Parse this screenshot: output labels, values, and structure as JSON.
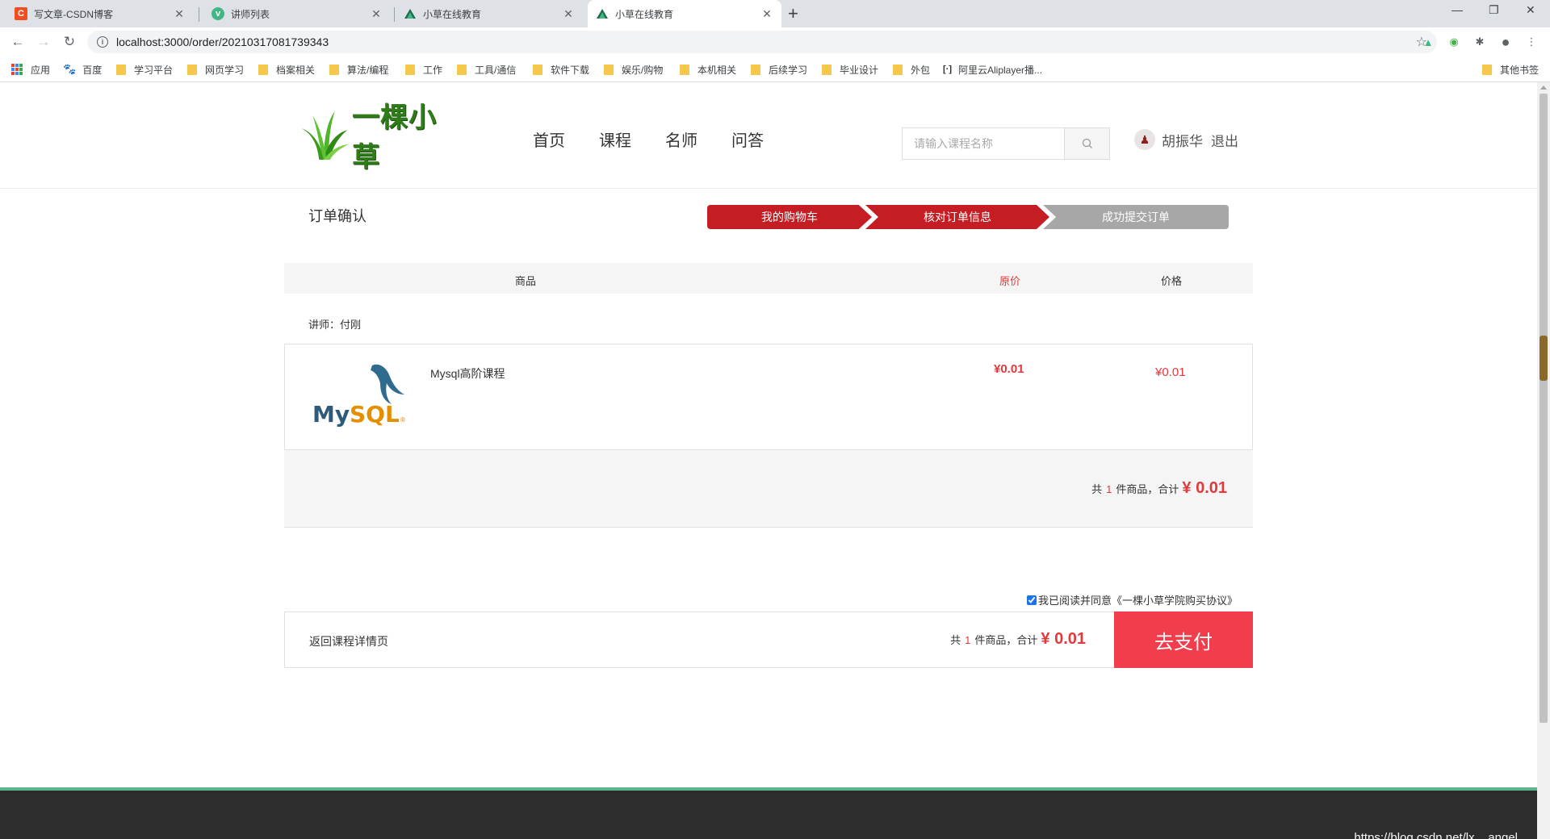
{
  "browser": {
    "tabs": [
      {
        "title": "写文章-CSDN博客",
        "icon": "csdn-icon",
        "icon_color": "#f04e22"
      },
      {
        "title": "讲师列表",
        "icon": "vue-icon",
        "icon_color": "#41b883"
      },
      {
        "title": "小草在线教育",
        "icon": "vuetify-icon",
        "icon_color": "#1d6b4a"
      },
      {
        "title": "小草在线教育",
        "icon": "vuetify-icon",
        "icon_color": "#1d6b4a"
      }
    ],
    "url": "localhost:3000/order/20210317081739343",
    "bookmarks": [
      {
        "label": "应用",
        "icon": "apps-icon"
      },
      {
        "label": "百度",
        "icon": "baidu-icon"
      },
      {
        "label": "学习平台",
        "icon": "folder-icon"
      },
      {
        "label": "网页学习",
        "icon": "folder-icon"
      },
      {
        "label": "档案相关",
        "icon": "folder-icon"
      },
      {
        "label": "算法/编程",
        "icon": "folder-icon"
      },
      {
        "label": "工作",
        "icon": "folder-icon"
      },
      {
        "label": "工具/通信",
        "icon": "folder-icon"
      },
      {
        "label": "软件下载",
        "icon": "folder-icon"
      },
      {
        "label": "娱乐/购物",
        "icon": "folder-icon"
      },
      {
        "label": "本机相关",
        "icon": "folder-icon"
      },
      {
        "label": "后续学习",
        "icon": "folder-icon"
      },
      {
        "label": "毕业设计",
        "icon": "folder-icon"
      },
      {
        "label": "外包",
        "icon": "folder-icon"
      },
      {
        "label": "阿里云Aliplayer播...",
        "icon": "code-icon"
      }
    ],
    "other_bookmarks": "其他书签"
  },
  "site": {
    "logo_text": "一棵小草",
    "nav": [
      "首页",
      "课程",
      "名师",
      "问答"
    ],
    "search_placeholder": "请输入课程名称",
    "user_name": "胡振华",
    "logout": "退出"
  },
  "order": {
    "title": "订单确认",
    "steps": [
      "我的购物车",
      "核对订单信息",
      "成功提交订单"
    ],
    "active_step_color": "#c51d24",
    "inactive_step_color": "#a7a7a7",
    "columns": {
      "product": "商品",
      "original_price": "原价",
      "price": "价格"
    },
    "teacher_label": "讲师：付刚",
    "item": {
      "name": "Mysql高阶课程",
      "thumb_text": "MySQL",
      "original_price": "¥0.01",
      "price": "¥0.01"
    },
    "summary": {
      "prefix": "共",
      "count": "1",
      "suffix": "件商品，合计",
      "total": "¥ 0.01"
    },
    "agreement": "我已阅读并同意《一棵小草学院购买协议》",
    "agreement_checked": true,
    "back_link": "返回课程详情页",
    "pay_button": "去支付",
    "accent_color": "#e4393c",
    "pay_color": "#f23d4d"
  },
  "watermark": "https://blog.csdn.net/lx__angel"
}
